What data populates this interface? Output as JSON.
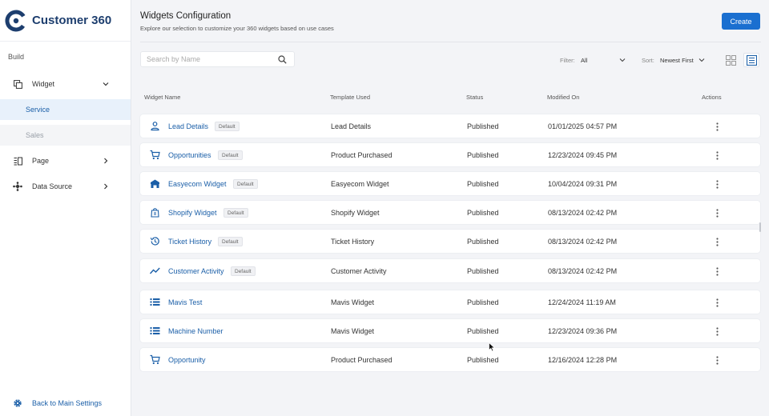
{
  "app": {
    "title": "Customer 360"
  },
  "sidebar": {
    "section": "Build",
    "widget": {
      "label": "Widget"
    },
    "sub_items": [
      {
        "label": "Service",
        "active": true
      },
      {
        "label": "Sales",
        "active": false
      }
    ],
    "page": {
      "label": "Page"
    },
    "data_source": {
      "label": "Data Source"
    },
    "back": {
      "label": "Back to Main Settings"
    }
  },
  "header": {
    "title": "Widgets Configuration",
    "subtitle": "Explore our selection to customize your 360 widgets based on use cases",
    "create_label": "Create"
  },
  "toolbar": {
    "search_placeholder": "Search by Name",
    "filter_label": "Filter:",
    "filter_value": "All",
    "sort_label": "Sort:",
    "sort_value": "Newest First"
  },
  "table": {
    "columns": [
      "Widget Name",
      "Template Used",
      "Status",
      "Modified On",
      "Actions"
    ],
    "rows": [
      {
        "icon": "person-icon",
        "name": "Lead Details",
        "badge": "Default",
        "template": "Lead Details",
        "status": "Published",
        "modified": "01/01/2025 04:57 PM"
      },
      {
        "icon": "cart-icon",
        "name": "Opportunities",
        "badge": "Default",
        "template": "Product Purchased",
        "status": "Published",
        "modified": "12/23/2024 09:45 PM"
      },
      {
        "icon": "store-icon",
        "name": "Easyecom Widget",
        "badge": "Default",
        "template": "Easyecom Widget",
        "status": "Published",
        "modified": "10/04/2024 09:31 PM"
      },
      {
        "icon": "shopify-bag-icon",
        "name": "Shopify Widget",
        "badge": "Default",
        "template": "Shopify Widget",
        "status": "Published",
        "modified": "08/13/2024 02:42 PM"
      },
      {
        "icon": "history-icon",
        "name": "Ticket History",
        "badge": "Default",
        "template": "Ticket History",
        "status": "Published",
        "modified": "08/13/2024 02:42 PM"
      },
      {
        "icon": "trending-icon",
        "name": "Customer Activity",
        "badge": "Default",
        "template": "Customer Activity",
        "status": "Published",
        "modified": "08/13/2024 02:42 PM"
      },
      {
        "icon": "list-icon",
        "name": "Mavis Test",
        "badge": "",
        "template": "Mavis Widget",
        "status": "Published",
        "modified": "12/24/2024 11:19 AM"
      },
      {
        "icon": "list-icon",
        "name": "Machine Number",
        "badge": "",
        "template": "Mavis Widget",
        "status": "Published",
        "modified": "12/23/2024 09:36 PM"
      },
      {
        "icon": "cart-icon",
        "name": "Opportunity",
        "badge": "",
        "template": "Product Purchased",
        "status": "Published",
        "modified": "12/16/2024 12:28 PM"
      }
    ]
  },
  "colors": {
    "accent": "#1a6fd0",
    "link": "#1b5fa8",
    "brand": "#1d3e6e",
    "active_bg": "#e8f1fb"
  }
}
